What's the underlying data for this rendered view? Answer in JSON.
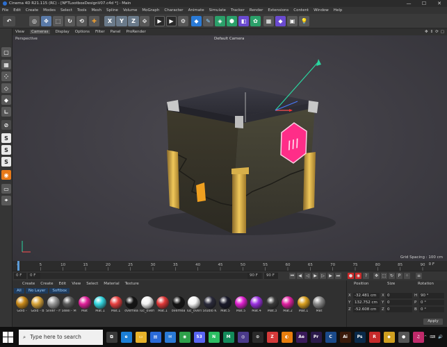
{
  "window": {
    "title": "Cinema 4D R21.115 (RC) - [NFTLootboxDesignV07.c4d *] - Main",
    "controls": [
      "—",
      "☐",
      "✕"
    ]
  },
  "menubar": [
    "File",
    "Edit",
    "Create",
    "Modes",
    "Select",
    "Tools",
    "Mesh",
    "Spline",
    "Volume",
    "MoGraph",
    "Character",
    "Animate",
    "Simulate",
    "Tracker",
    "Render",
    "Extensions",
    "Content",
    "Window",
    "Help"
  ],
  "toolbar": {
    "axis_labels": [
      "X",
      "Y",
      "Z"
    ]
  },
  "left_tools": [
    "S",
    "S",
    "S"
  ],
  "viewport_menu": {
    "items": [
      "View",
      "Cameras",
      "Display",
      "Options",
      "Filter",
      "Panel",
      "ProRender"
    ],
    "active": "Cameras"
  },
  "viewport": {
    "view_name": "Perspective",
    "camera": "Default Camera",
    "grid_spacing": "Grid Spacing : 100 cm",
    "colors": {
      "pink_badge": "#ff2d88",
      "gold": "#e6b64a",
      "box_body": "#3a372a"
    }
  },
  "timeline": {
    "ticks": [
      "0",
      "5",
      "10",
      "15",
      "20",
      "25",
      "30",
      "35",
      "40",
      "45",
      "50",
      "55",
      "60",
      "65",
      "70",
      "75",
      "80",
      "85",
      "90"
    ],
    "end_frame": "0 F"
  },
  "playbar": {
    "start": "0 F",
    "current": "0 F",
    "end": "90 F",
    "end2": "90 F"
  },
  "material_menu": [
    "Create",
    "Create",
    "Edit",
    "View",
    "Select",
    "Material",
    "Texture"
  ],
  "material_filters": [
    "All",
    "No Layer",
    "Softbox"
  ],
  "materials": [
    {
      "label": "Gold -",
      "color": "#c98a1a"
    },
    {
      "label": "Gold - B",
      "color": "#d9a53a"
    },
    {
      "label": "Silver - H",
      "color": "#9a9a9a"
    },
    {
      "label": "Steel - M",
      "color": "#5a5a5a"
    },
    {
      "label": "Mat",
      "color": "#e0209a"
    },
    {
      "label": "Mat.1",
      "color": "#33d6e0"
    },
    {
      "label": "Mat.1",
      "color": "#e84040"
    },
    {
      "label": "overhea",
      "color": "#151515"
    },
    {
      "label": "luc_overl",
      "color": "#f2f2f2"
    },
    {
      "label": "Mat.1",
      "color": "#e03838"
    },
    {
      "label": "overhea",
      "color": "#151515"
    },
    {
      "label": "luc_overl",
      "color": "#f4f4f4"
    },
    {
      "label": "Studio K",
      "color": "#2a2a3a"
    },
    {
      "label": "Mat.5",
      "color": "#1a1a2a"
    },
    {
      "label": "Mat.5",
      "color": "#e020d0"
    },
    {
      "label": "Mat.4",
      "color": "#9a30e0"
    },
    {
      "label": "Mat.3",
      "color": "#3a3a3a"
    },
    {
      "label": "Mat.2",
      "color": "#e020a0"
    },
    {
      "label": "Mat.1",
      "color": "#d9a020"
    },
    {
      "label": "Mat",
      "color": "#8a8a8a"
    }
  ],
  "attributes": {
    "headers": [
      "Position",
      "Size",
      "Rotation"
    ],
    "rows": [
      {
        "axis": "X",
        "pos": "-32.481 cm",
        "size": "0",
        "rot_label": "H",
        "rot": "90 °"
      },
      {
        "axis": "Y",
        "pos": "132.752 cm",
        "size": "0",
        "rot_label": "P",
        "rot": "0 °"
      },
      {
        "axis": "Z",
        "pos": "-52.608 cm",
        "size": "0",
        "rot_label": "B",
        "rot": "0 °"
      }
    ],
    "apply_label": "Apply"
  },
  "taskbar": {
    "search_placeholder": "Type here to search",
    "apps": [
      {
        "name": "task-view",
        "color": "#3a3a3a",
        "glyph": "⧉"
      },
      {
        "name": "edge",
        "color": "#1b7ed6",
        "glyph": "e"
      },
      {
        "name": "explorer",
        "color": "#e8b32a",
        "glyph": "▭"
      },
      {
        "name": "store",
        "color": "#2a6ad8",
        "glyph": "▤"
      },
      {
        "name": "mail",
        "color": "#2a7ad6",
        "glyph": "✉"
      },
      {
        "name": "chrome",
        "color": "#2ea04a",
        "glyph": "◉"
      },
      {
        "name": "discord",
        "color": "#5865f2",
        "glyph": "53"
      },
      {
        "name": "app-green",
        "color": "#2bbd62",
        "glyph": "N"
      },
      {
        "name": "app-teal",
        "color": "#138a5a",
        "glyph": "M"
      },
      {
        "name": "app-purple",
        "color": "#4a3a8a",
        "glyph": "◎"
      },
      {
        "name": "app-dark",
        "color": "#2a2a2a",
        "glyph": "⊙"
      },
      {
        "name": "zbrush",
        "color": "#d43a3a",
        "glyph": "Z"
      },
      {
        "name": "blender",
        "color": "#e87d0d",
        "glyph": "◐"
      },
      {
        "name": "aftereffects",
        "color": "#3a1a5a",
        "glyph": "Ae"
      },
      {
        "name": "premiere",
        "color": "#2a1a4a",
        "glyph": "Pr"
      },
      {
        "name": "cinema4d",
        "color": "#1a4a8a",
        "glyph": "C"
      },
      {
        "name": "illustrator",
        "color": "#3a1a0a",
        "glyph": "Ai"
      },
      {
        "name": "photoshop",
        "color": "#0a2a4a",
        "glyph": "Ps"
      },
      {
        "name": "app-red",
        "color": "#c62a2a",
        "glyph": "R"
      },
      {
        "name": "app-yellow",
        "color": "#d0a020",
        "glyph": "◆"
      },
      {
        "name": "app-gray",
        "color": "#555555",
        "glyph": "●"
      },
      {
        "name": "app-pink",
        "color": "#c02a6a",
        "glyph": "♫"
      }
    ],
    "tray": [
      "^",
      "⌨",
      "🔊"
    ]
  }
}
